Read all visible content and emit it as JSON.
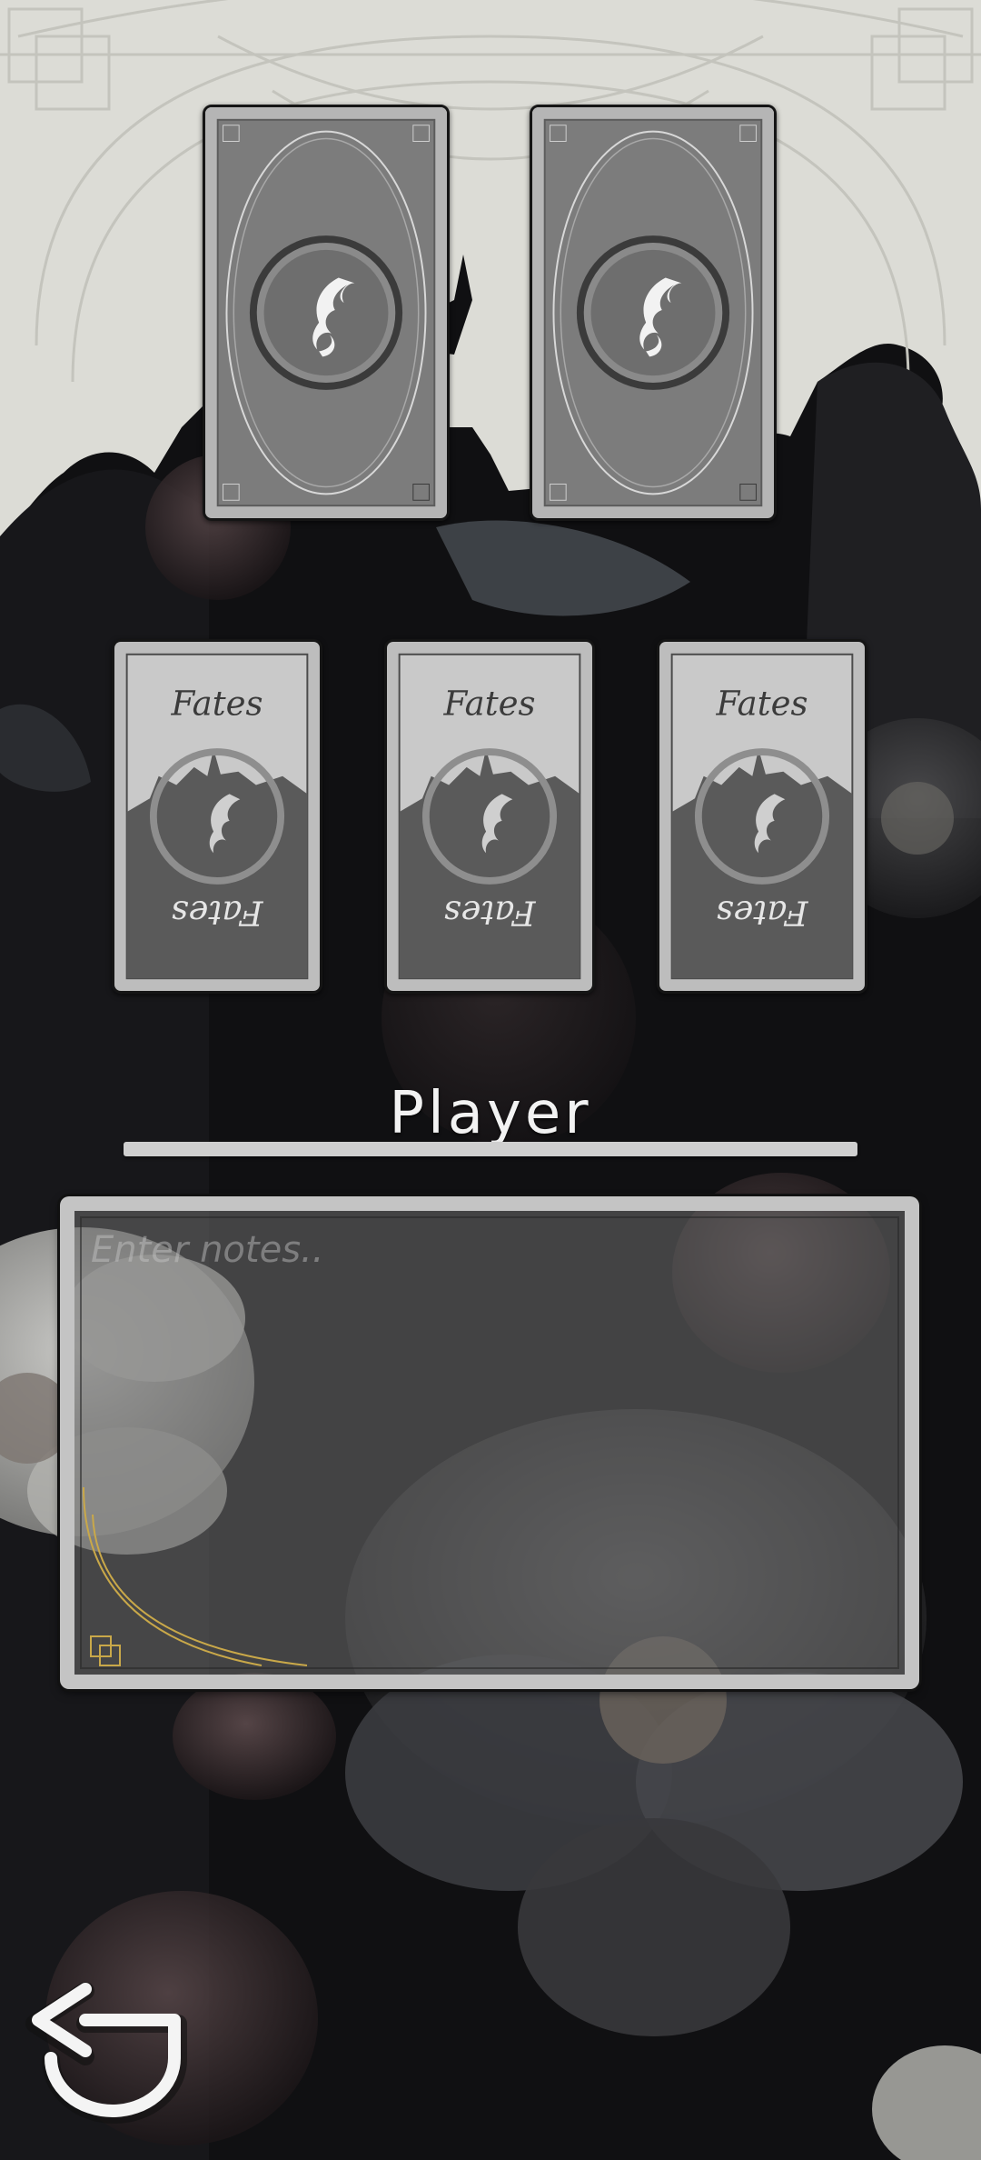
{
  "colors": {
    "top_background": "#dcdcd6",
    "card_back_fill": "#7c7c7c",
    "card_face_fill": "#c9c9c9",
    "frame_grey": "#c4c4c4",
    "accent_gold": "#c9a849"
  },
  "deck": {
    "cards": [
      {
        "icon": "phoenix-emblem-icon"
      },
      {
        "icon": "phoenix-emblem-icon"
      }
    ]
  },
  "hand": {
    "cards": [
      {
        "title": "Fates",
        "icon": "castle-phoenix-emblem-icon"
      },
      {
        "title": "Fates",
        "icon": "castle-phoenix-emblem-icon"
      },
      {
        "title": "Fates",
        "icon": "castle-phoenix-emblem-icon"
      }
    ]
  },
  "player": {
    "name": "Player"
  },
  "notes": {
    "placeholder": "Enter notes..",
    "value": ""
  },
  "navigation": {
    "back_icon": "back-arrow-icon"
  }
}
